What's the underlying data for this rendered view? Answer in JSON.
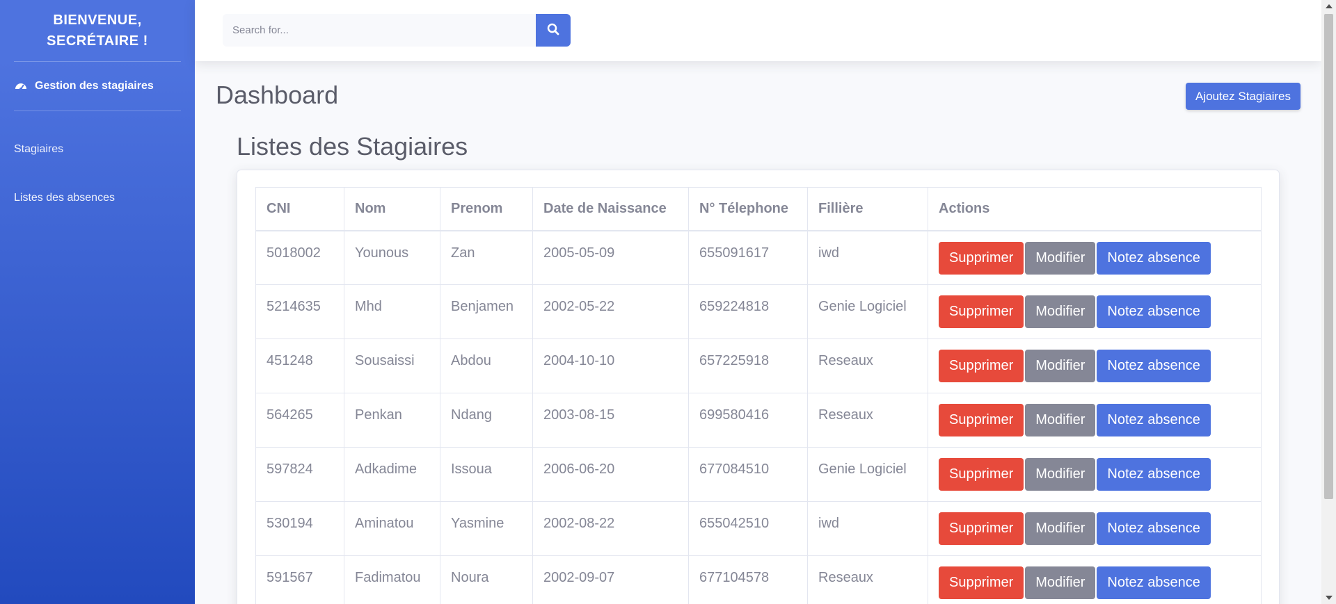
{
  "sidebar": {
    "brand": "BIENVENUE, SECRÉTAIRE !",
    "active_item": "Gestion des stagiaires",
    "items": [
      {
        "label": "Stagiaires"
      },
      {
        "label": "Listes des absences"
      }
    ]
  },
  "search": {
    "placeholder": "Search for..."
  },
  "page": {
    "title": "Dashboard",
    "add_button": "Ajoutez Stagiaires",
    "list_title": "Listes des Stagiaires"
  },
  "table": {
    "headers": [
      "CNI",
      "Nom",
      "Prenom",
      "Date de Naissance",
      "N° Télephone",
      "Fillière",
      "Actions"
    ],
    "rows": [
      [
        "5018002",
        "Younous",
        "Zan",
        "2005-05-09",
        "655091617",
        "iwd"
      ],
      [
        "5214635",
        "Mhd",
        "Benjamen",
        "2002-05-22",
        "659224818",
        "Genie Logiciel"
      ],
      [
        "451248",
        "Sousaissi",
        "Abdou",
        "2004-10-10",
        "657225918",
        "Reseaux"
      ],
      [
        "564265",
        "Penkan",
        "Ndang",
        "2003-08-15",
        "699580416",
        "Reseaux"
      ],
      [
        "597824",
        "Adkadime",
        "Issoua",
        "2006-06-20",
        "677084510",
        "Genie Logiciel"
      ],
      [
        "530194",
        "Aminatou",
        "Yasmine",
        "2002-08-22",
        "655042510",
        "iwd"
      ],
      [
        "591567",
        "Fadimatou",
        "Noura",
        "2002-09-07",
        "677104578",
        "Reseaux"
      ]
    ],
    "actions": {
      "delete": "Supprimer",
      "edit": "Modifier",
      "absence": "Notez absence"
    }
  },
  "colors": {
    "primary": "#4e73df",
    "danger": "#e74a3b",
    "secondary": "#858796"
  }
}
